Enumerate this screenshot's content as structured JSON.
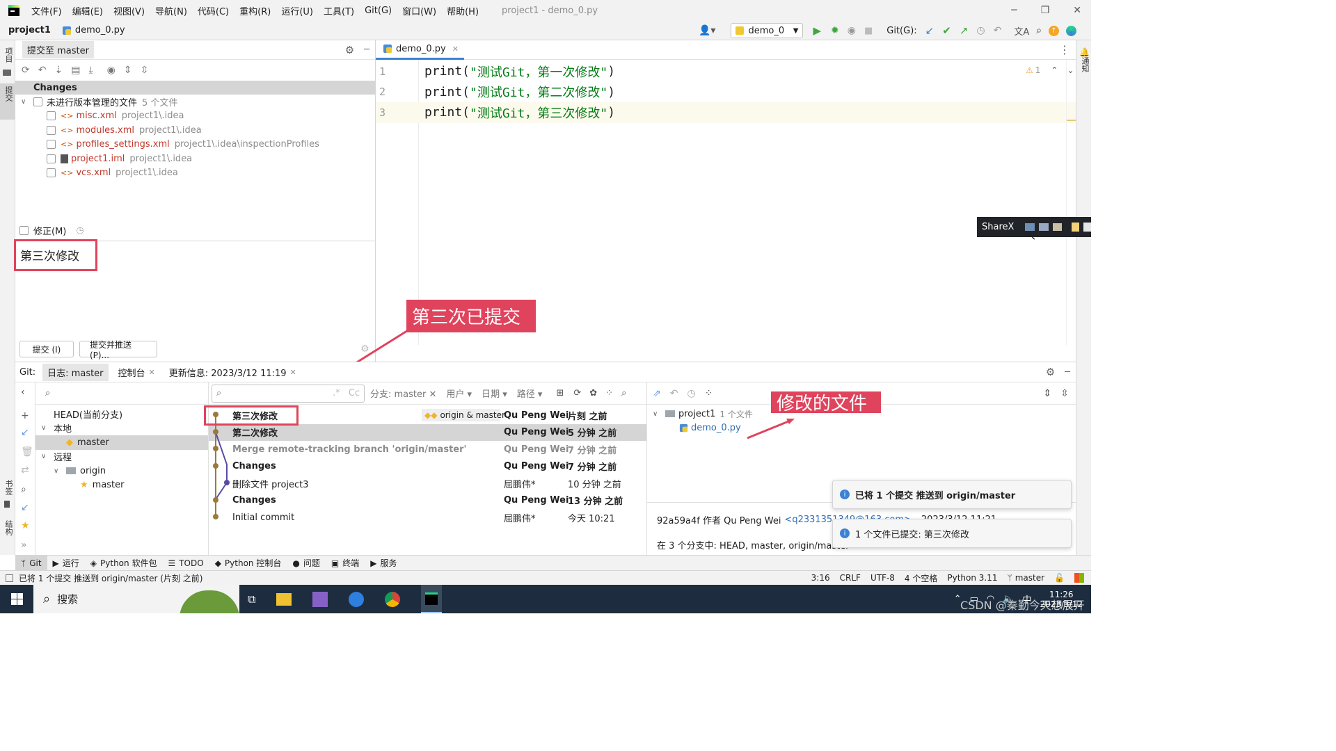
{
  "menu": {
    "items": [
      "文件(F)",
      "编辑(E)",
      "视图(V)",
      "导航(N)",
      "代码(C)",
      "重构(R)",
      "运行(U)",
      "工具(T)",
      "Git(G)",
      "窗口(W)",
      "帮助(H)"
    ],
    "title": "project1 - demo_0.py"
  },
  "nav": {
    "project": "project1",
    "file": "demo_0.py",
    "run_config": "demo_0",
    "git_label": "Git(G):"
  },
  "side": {
    "left_top": "项目",
    "left_commit": "提交",
    "left_bookmarks": "书签",
    "left_structure": "结构",
    "right_notify": "通知"
  },
  "commit_panel": {
    "title": "提交至 master",
    "changes_header": "Changes",
    "unversioned_label": "未进行版本管理的文件",
    "unversioned_count": "5 个文件",
    "files": [
      {
        "name": "misc.xml",
        "path": "project1\\.idea"
      },
      {
        "name": "modules.xml",
        "path": "project1\\.idea"
      },
      {
        "name": "profiles_settings.xml",
        "path": "project1\\.idea\\inspectionProfiles"
      },
      {
        "name": "project1.iml",
        "path": "project1\\.idea"
      },
      {
        "name": "vcs.xml",
        "path": "project1\\.idea"
      }
    ],
    "amend_label": "修正(M)",
    "message": "第三次修改",
    "commit_button": "提交 (I)",
    "commit_push_button": "提交并推送(P)..."
  },
  "editor": {
    "tab": "demo_0.py",
    "warnings": "1",
    "lines": [
      {
        "num": "1",
        "fn": "print(",
        "str": "\"测试Git，第一次修改\"",
        "end": ")"
      },
      {
        "num": "2",
        "fn": "print(",
        "str": "\"测试Git，第二次修改\"",
        "end": ")"
      },
      {
        "num": "3",
        "fn": "print(",
        "str": "\"测试Git，第三次修改\"",
        "end": ")"
      }
    ]
  },
  "sharex": {
    "label": "ShareX"
  },
  "git": {
    "label": "Git:",
    "tab_log": "日志: master",
    "tab_console": "控制台",
    "update_info": "更新信息: 2023/3/12 11:19",
    "branch_filter": "分支: master",
    "user_filter": "用户",
    "date_filter": "日期",
    "path_filter": "路径",
    "branches": {
      "head": "HEAD(当前分支)",
      "local": "本地",
      "local_master": "master",
      "remote": "远程",
      "origin": "origin",
      "origin_master": "master"
    },
    "commits": [
      {
        "msg": "第三次修改",
        "refs": "origin & master",
        "author": "Qu Peng Wei",
        "time": "片刻 之前",
        "bold": true
      },
      {
        "msg": "第二次修改",
        "refs": "",
        "author": "Qu Peng Wei",
        "time": "5 分钟 之前",
        "bold": true
      },
      {
        "msg": "Merge remote-tracking branch 'origin/master'",
        "refs": "",
        "author": "Qu Peng Wei",
        "time": "7 分钟 之前",
        "bold": false,
        "grey": true
      },
      {
        "msg": "Changes",
        "refs": "",
        "author": "Qu Peng Wei",
        "time": "7 分钟 之前",
        "bold": true
      },
      {
        "msg": "删除文件 project3",
        "refs": "",
        "author": "屈鹏伟*",
        "time": "10 分钟 之前",
        "bold": false
      },
      {
        "msg": "Changes",
        "refs": "",
        "author": "Qu Peng Wei",
        "time": "13 分钟 之前",
        "bold": true
      },
      {
        "msg": "Initial commit",
        "refs": "",
        "author": "屈鹏伟*",
        "time": "今天 10:21",
        "bold": false
      }
    ],
    "details": {
      "root": "project1",
      "root_count": "1 个文件",
      "file": "demo_0.py",
      "hash_line": "92a59a4f 作者 Qu Peng Wei",
      "email": "<q2331351349@163.com>",
      "date": "2023/3/12 11:21",
      "branches_line": "在 3 个分支中: HEAD, master, origin/master"
    }
  },
  "annotations": {
    "committed": "第三次已提交",
    "modified_files": "修改的文件"
  },
  "notifications": [
    {
      "text": "已将 1 个提交 推送到 origin/master"
    },
    {
      "text": "1 个文件已提交: 第三次修改"
    }
  ],
  "toolstrip": [
    "Git",
    "运行",
    "Python 软件包",
    "TODO",
    "Python 控制台",
    "问题",
    "终端",
    "服务"
  ],
  "status": {
    "message": "已将 1 个提交 推送到 origin/master (片刻 之前)",
    "position": "3:16",
    "line_sep": "CRLF",
    "encoding": "UTF-8",
    "indent": "4 个空格",
    "interpreter": "Python 3.11",
    "branch": "master"
  },
  "taskbar": {
    "search": "搜索",
    "time": "11:26",
    "date": "2023/3/12",
    "ime": "中",
    "watermark": "CSDN @秦勤今天想展开"
  }
}
